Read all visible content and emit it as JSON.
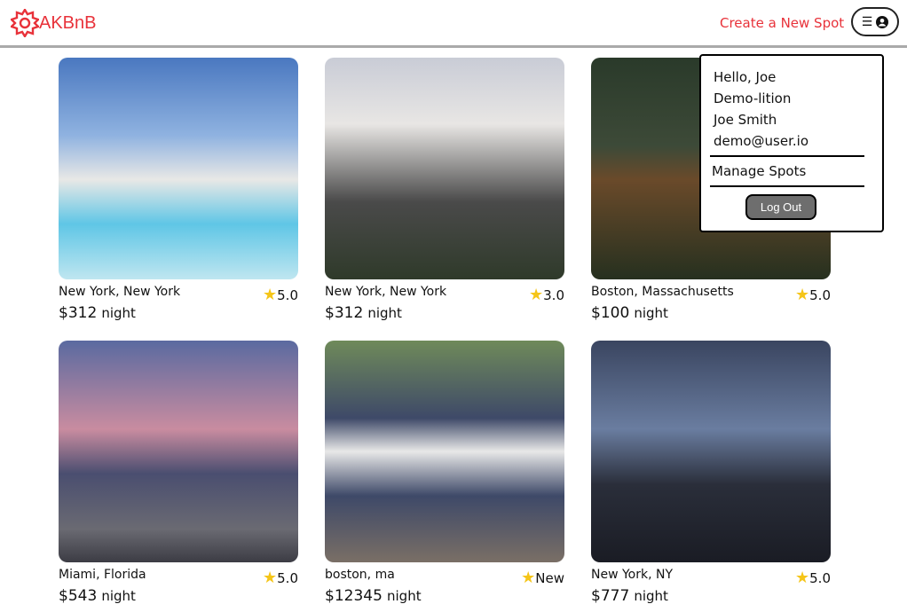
{
  "header": {
    "logo_text": "AKBnB",
    "create_spot": "Create a New Spot",
    "menu_icon": "hamburger-icon",
    "profile_icon": "user-circle-icon"
  },
  "dropdown": {
    "greeting": "Hello, Joe",
    "username": "Demo-lition",
    "full_name": "Joe Smith",
    "email": "demo@user.io",
    "manage": "Manage Spots",
    "logout": "Log Out"
  },
  "colors": {
    "brand": "#e8323a",
    "star": "#f5c518"
  },
  "spots": [
    {
      "location": "New York, New York",
      "rating": "5.0",
      "price": "$312",
      "unit": "night"
    },
    {
      "location": "New York, New York",
      "rating": "3.0",
      "price": "$312",
      "unit": "night"
    },
    {
      "location": "Boston, Massachusetts",
      "rating": "5.0",
      "price": "$100",
      "unit": "night"
    },
    {
      "location": "Miami, Florida",
      "rating": "5.0",
      "price": "$543",
      "unit": "night"
    },
    {
      "location": "boston, ma",
      "rating": "New",
      "price": "$12345",
      "unit": "night"
    },
    {
      "location": "New York, NY",
      "rating": "5.0",
      "price": "$777",
      "unit": "night"
    }
  ]
}
